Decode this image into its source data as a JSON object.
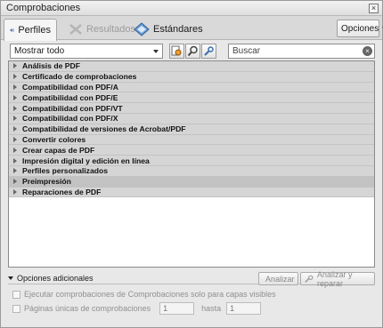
{
  "window": {
    "title": "Comprobaciones"
  },
  "tabs": [
    {
      "label": "Perfiles",
      "state": "active"
    },
    {
      "label": "Resultados",
      "state": "disabled"
    },
    {
      "label": "Estándares",
      "state": "normal"
    }
  ],
  "options_label": "Opciones",
  "filter": {
    "selected": "Mostrar todo"
  },
  "search": {
    "placeholder": "Buscar"
  },
  "categories": [
    "Análisis de PDF",
    "Certificado de comprobaciones",
    "Compatibilidad con PDF/A",
    "Compatibilidad con PDF/E",
    "Compatibilidad con PDF/VT",
    "Compatibilidad con PDF/X",
    "Compatibilidad de versiones de Acrobat/PDF",
    "Convertir colores",
    "Crear capas de PDF",
    "Impresión digital y edición en línea",
    "Perfiles personalizados",
    "Preimpresión",
    "Reparaciones de PDF"
  ],
  "selected_category": "Preimpresión",
  "footer": {
    "additional_options": "Opciones adicionales",
    "analyze": "Analizar",
    "analyze_repair": "Analizar y reparar",
    "visible_layers": "Ejecutar comprobaciones de Comprobaciones solo para capas visibles",
    "single_pages": "Páginas únicas de comprobaciones",
    "from_value": "1",
    "to_label": "hasta",
    "to_value": "1"
  }
}
